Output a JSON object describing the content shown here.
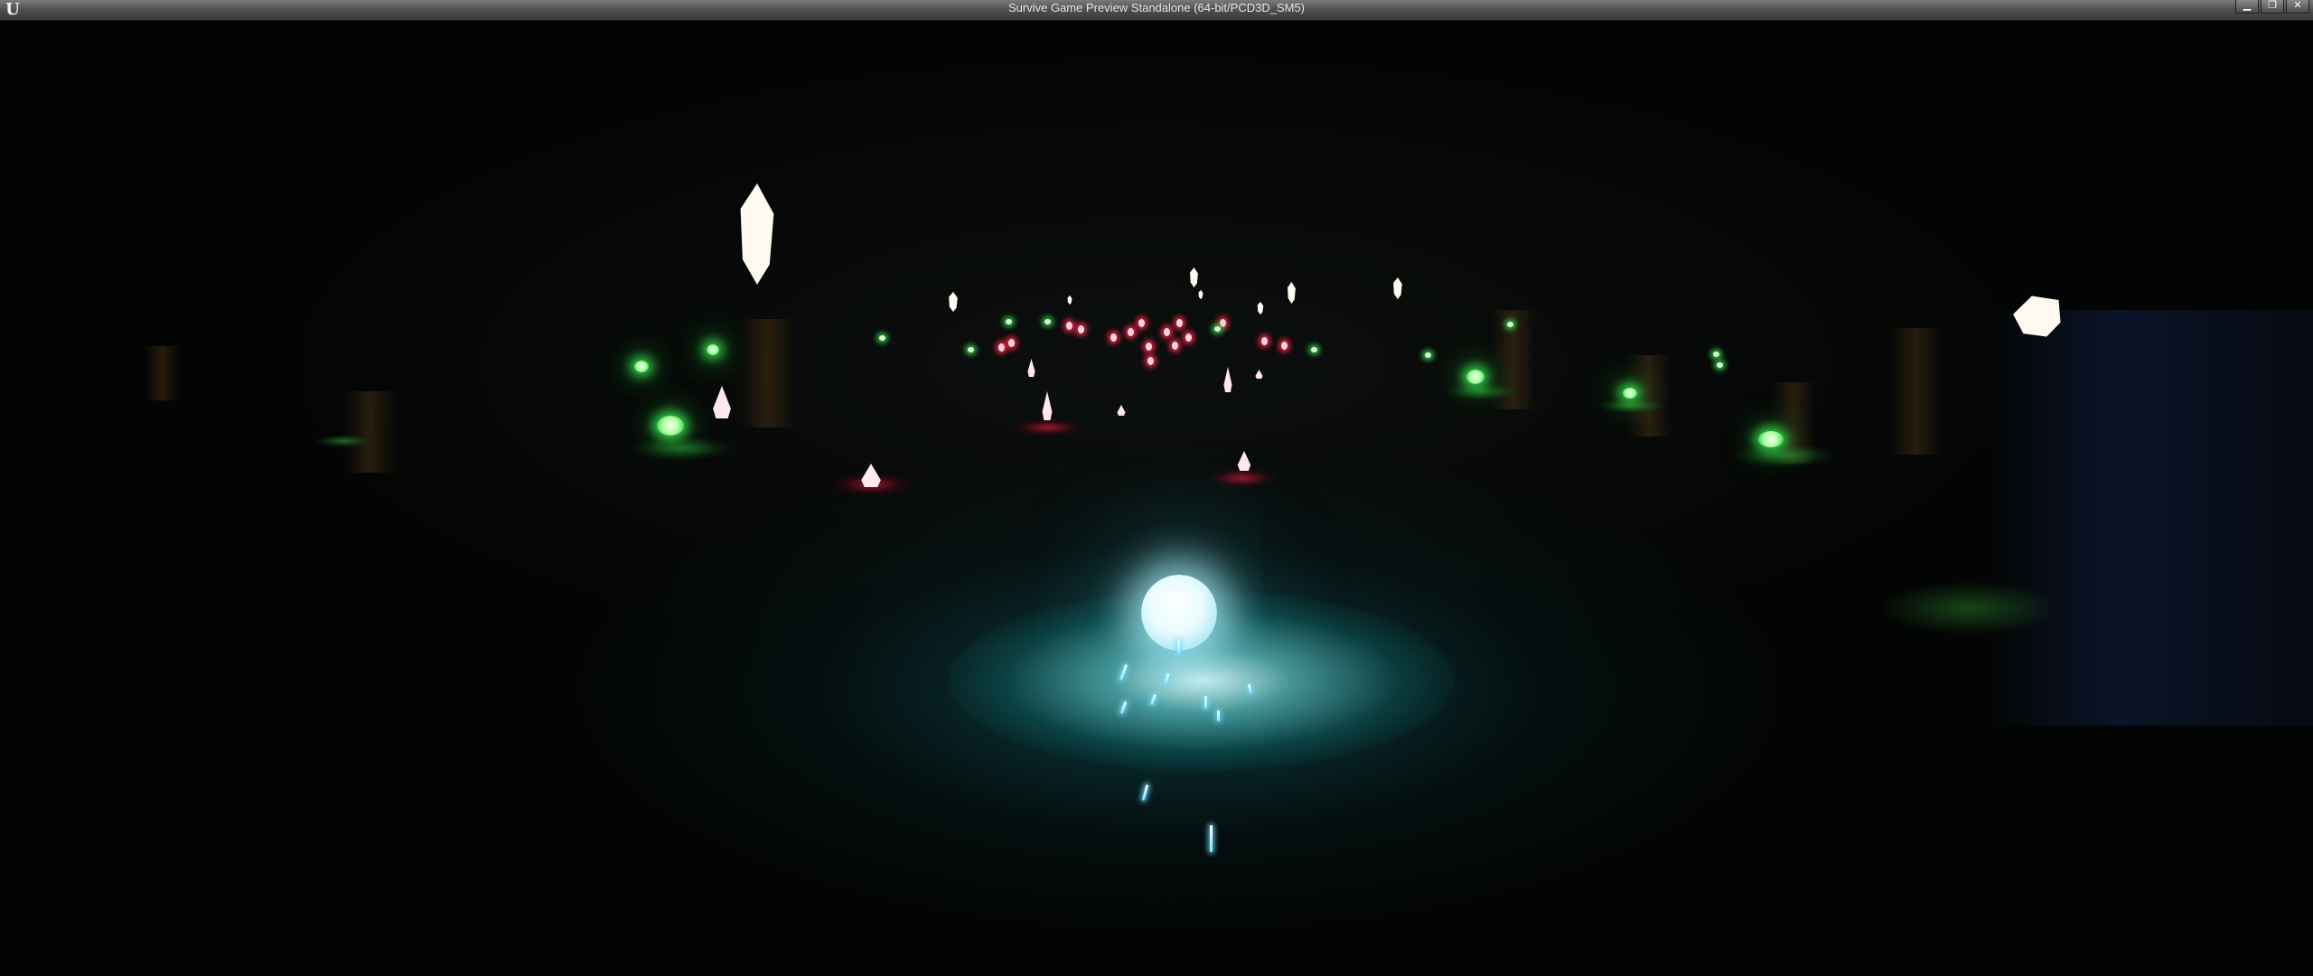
{
  "window": {
    "title": "Survive Game Preview Standalone (64-bit/PCD3D_SM5)",
    "logo_text": "U",
    "controls": {
      "minimize": "▁",
      "restore": "❐",
      "close": "✕"
    }
  },
  "scene": {
    "background": "#030504",
    "player_color": "#e8fbff",
    "crystal_white_color": "#fffaf0",
    "crystal_red_glow": "#ff2850",
    "gem_green_glow": "#3ce650"
  }
}
